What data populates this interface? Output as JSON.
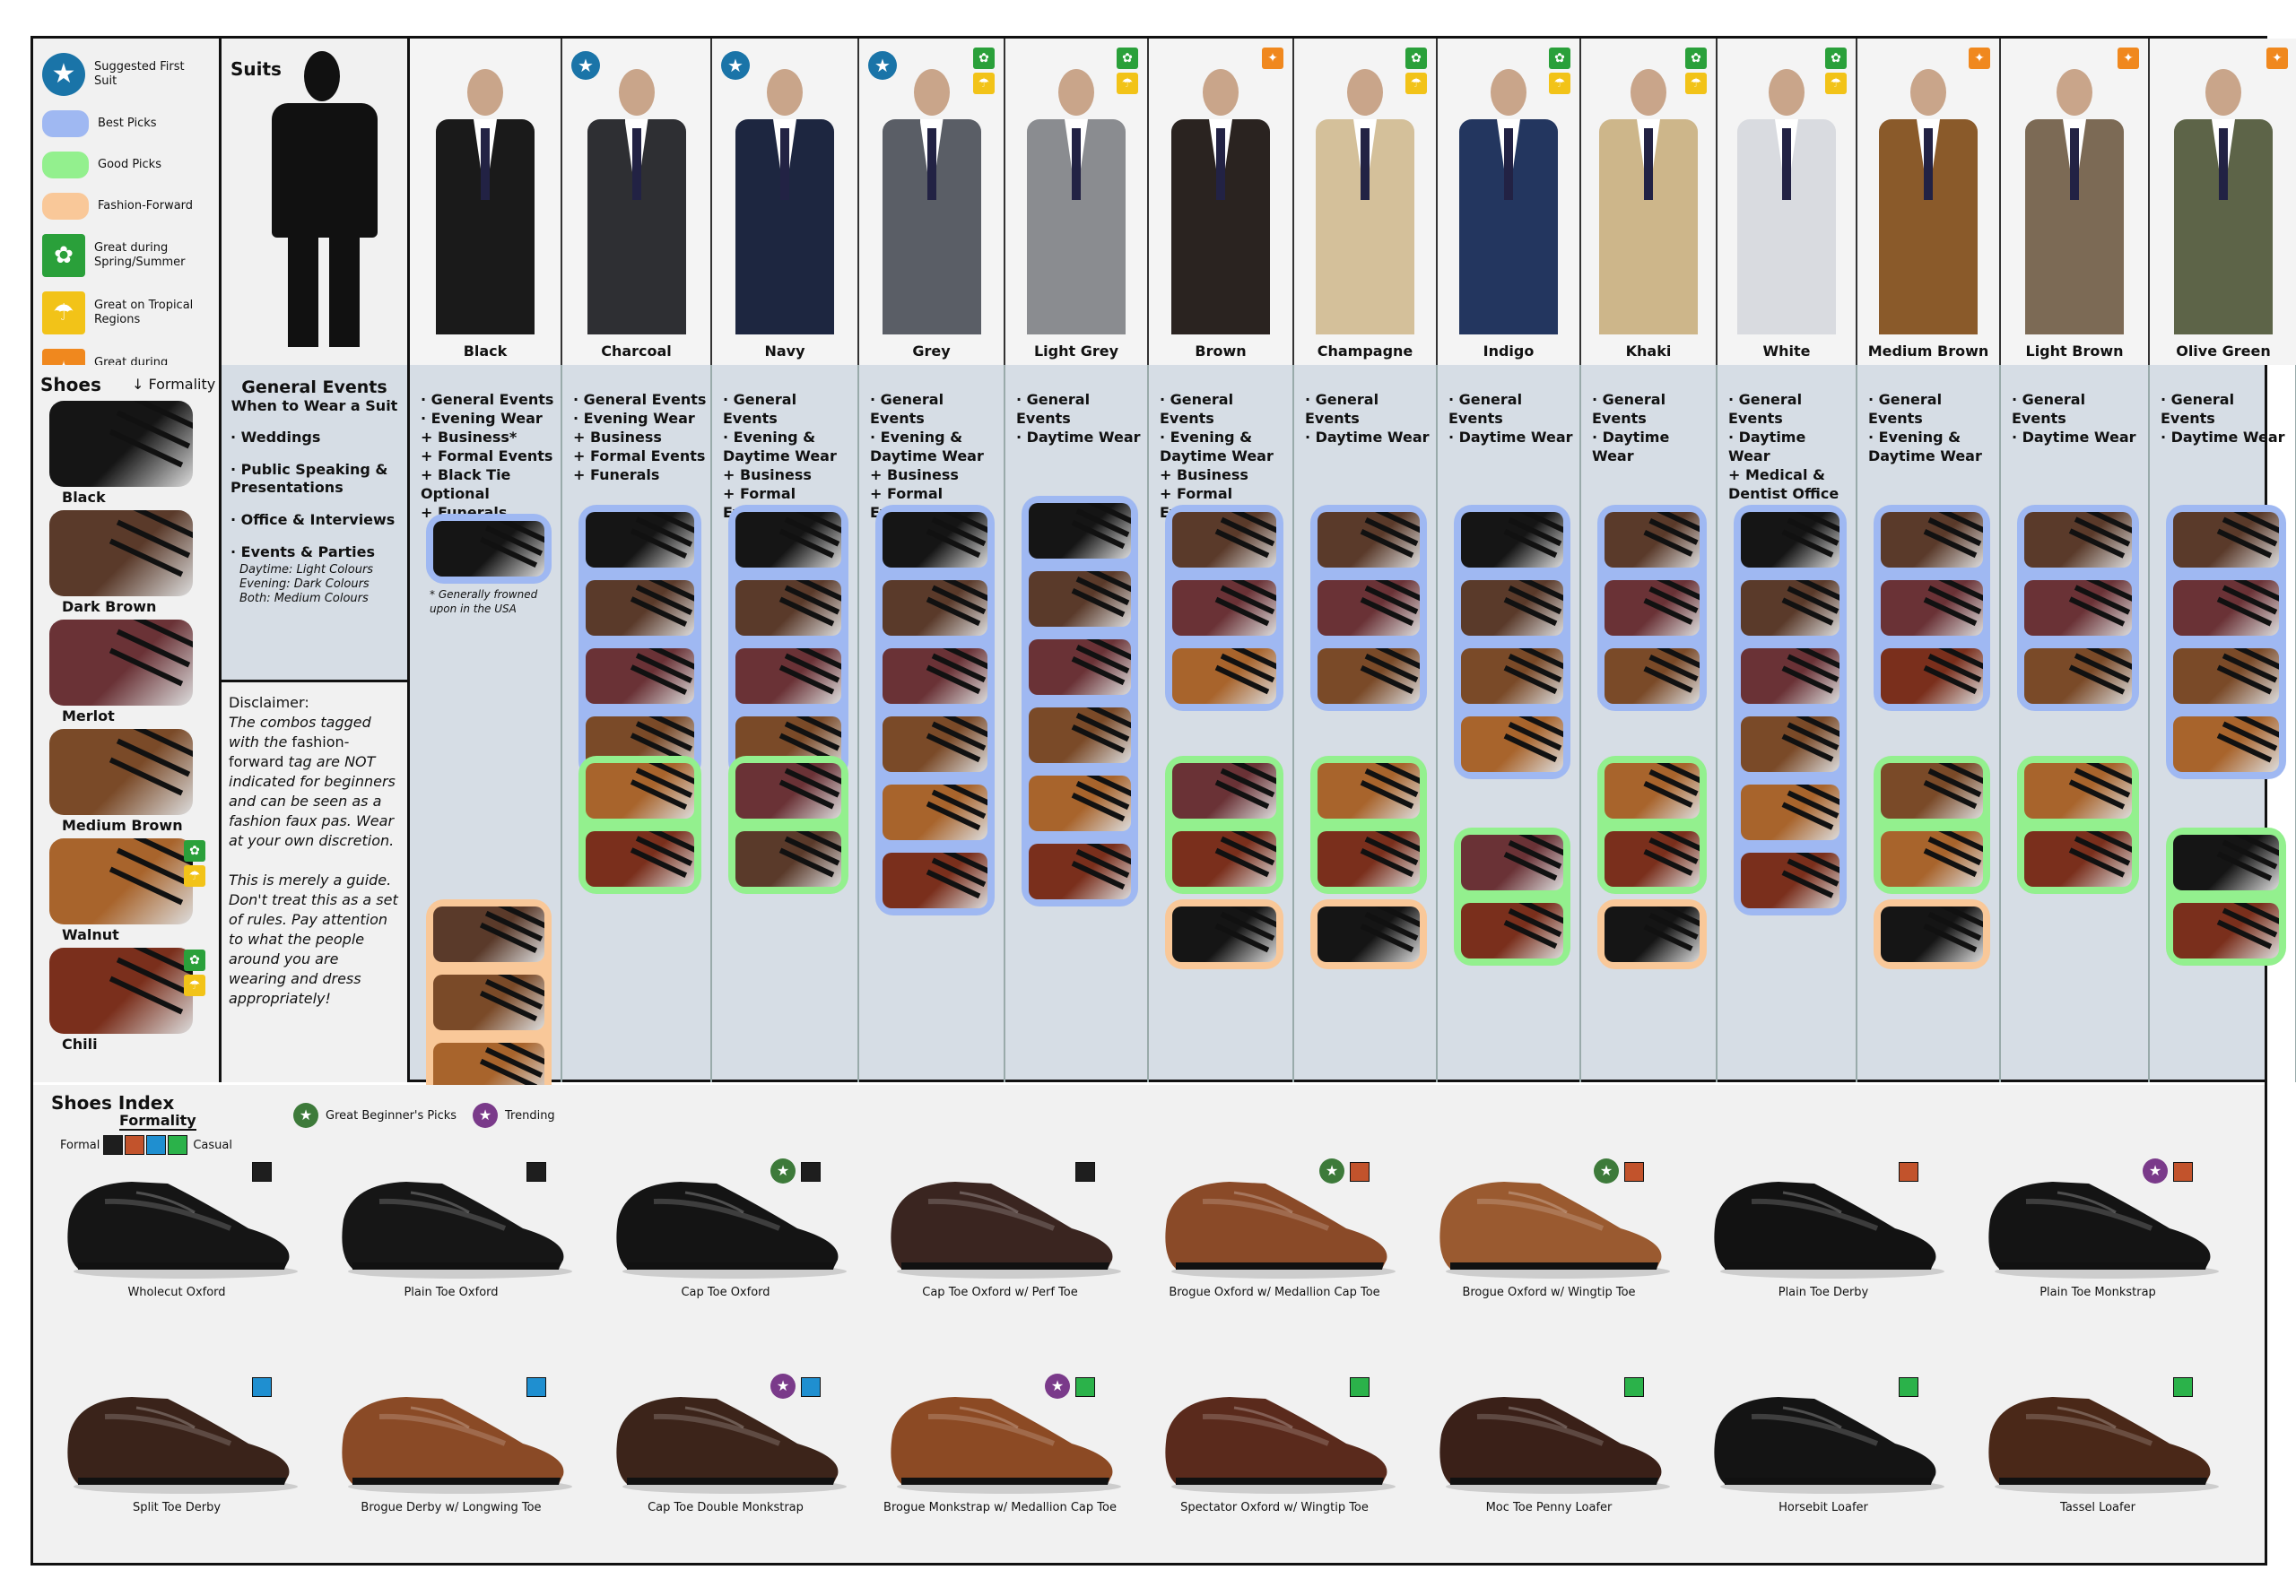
{
  "legend": {
    "first_suit": "Suggested First Suit",
    "best": "Best Picks",
    "good": "Good Picks",
    "fashion": "Fashion-Forward",
    "spring": "Great during Spring/Summer",
    "tropical": "Great on Tropical Regions",
    "autumn": "Great during Autumn",
    "colors": {
      "best": "#9fb8f2",
      "good": "#93f08e",
      "fashion": "#f9c899",
      "first_suit": "#1a74a8",
      "spring": "#2aa03a",
      "tropical": "#f2c318",
      "autumn": "#f0881e"
    }
  },
  "suits_title": "Suits",
  "suits": [
    {
      "name": "Black",
      "color": "#1a1a1a",
      "badges": []
    },
    {
      "name": "Charcoal",
      "color": "#2e2f33",
      "badges": [
        "star"
      ]
    },
    {
      "name": "Navy",
      "color": "#1d2640",
      "badges": [
        "star"
      ]
    },
    {
      "name": "Grey",
      "color": "#5a5e66",
      "badges": [
        "star",
        "spring",
        "tropical"
      ]
    },
    {
      "name": "Light Grey",
      "color": "#8a8c90",
      "badges": [
        "spring",
        "tropical"
      ]
    },
    {
      "name": "Brown",
      "color": "#2a2320",
      "badges": [
        "autumn"
      ]
    },
    {
      "name": "Champagne",
      "color": "#d4c09a",
      "badges": [
        "spring",
        "tropical"
      ]
    },
    {
      "name": "Indigo",
      "color": "#23365f",
      "badges": [
        "spring",
        "tropical"
      ]
    },
    {
      "name": "Khaki",
      "color": "#cdb68a",
      "badges": [
        "spring",
        "tropical"
      ]
    },
    {
      "name": "White",
      "color": "#d9dbe0",
      "badges": [
        "spring",
        "tropical"
      ]
    },
    {
      "name": "Medium Brown",
      "color": "#8a5a2a",
      "badges": [
        "autumn"
      ]
    },
    {
      "name": "Light Brown",
      "color": "#7c6a55",
      "badges": [
        "autumn"
      ]
    },
    {
      "name": "Olive Green",
      "color": "#5d6448",
      "badges": [
        "autumn"
      ]
    }
  ],
  "shoes_title": "Shoes",
  "formality_label": "↓ Formality",
  "shoes": [
    {
      "name": "Black",
      "color": "#151515",
      "badges": []
    },
    {
      "name": "Dark Brown",
      "color": "#5a3a2a",
      "badges": []
    },
    {
      "name": "Merlot",
      "color": "#6a3236",
      "badges": []
    },
    {
      "name": "Medium Brown",
      "color": "#7a4a28",
      "badges": []
    },
    {
      "name": "Walnut",
      "color": "#a8642c",
      "badges": [
        "spring",
        "tropical"
      ]
    },
    {
      "name": "Chili",
      "color": "#7a2f1c",
      "badges": [
        "spring",
        "tropical"
      ]
    }
  ],
  "events": {
    "title": "General Events",
    "subtitle": "When to Wear a Suit",
    "items": [
      "· Weddings",
      "· Public Speaking & Presentations",
      "· Office & Interviews",
      "· Events & Parties"
    ],
    "sub_notes": [
      "Daytime: Light Colours",
      "Evening: Dark Colours",
      "Both: Medium Colours"
    ]
  },
  "disclaimer": {
    "title": "Disclaimer:",
    "p1a": "The combos tagged with the",
    "p1b": "fashion-forward",
    "p1c": "tag are NOT indicated for beginners and can be seen as a fashion faux pas. Wear at your own discretion.",
    "p2": "This is merely a guide. Don't treat this as a set of rules. Pay attention to what the people around you are wearing and dress appropriately!"
  },
  "matrix": [
    {
      "text": "· General Events\n· Evening Wear\n+ Business*\n+ Formal Events\n+ Black Tie\n  Optional\n+ Funerals",
      "note": "* Generally frowned upon in the USA"
    },
    {
      "text": "· General Events\n· Evening Wear\n+ Business\n+ Formal Events\n+ Funerals",
      "note": ""
    },
    {
      "text": "· General Events\n· Evening &\n  Daytime Wear\n+ Business\n+ Formal Events",
      "note": ""
    },
    {
      "text": "· General Events\n· Evening &\n  Daytime Wear\n+ Business\n+ Formal Events",
      "note": ""
    },
    {
      "text": "· General Events\n· Daytime Wear",
      "note": ""
    },
    {
      "text": "· General Events\n· Evening &\n  Daytime Wear\n+ Business\n+ Formal Events",
      "note": ""
    },
    {
      "text": "· General Events\n· Daytime Wear",
      "note": ""
    },
    {
      "text": "· General Events\n· Daytime Wear",
      "note": ""
    },
    {
      "text": "· General Events\n· Daytime Wear",
      "note": ""
    },
    {
      "text": "· General Events\n· Daytime Wear\n+ Medical &\n  Dentist Office",
      "note": ""
    },
    {
      "text": "· General Events\n· Evening &\n  Daytime Wear",
      "note": ""
    },
    {
      "text": "· General Events\n· Daytime Wear",
      "note": ""
    },
    {
      "text": "· General Events\n· Daytime Wear",
      "note": ""
    }
  ],
  "index": {
    "title": "Shoes Index",
    "formality": "Formality",
    "formal": "Formal",
    "casual": "Casual",
    "beginner": "Great Beginner's Picks",
    "trending": "Trending",
    "scale_colors": [
      "#1e1e1e",
      "#c2532c",
      "#1f8fd0",
      "#2bb24a"
    ],
    "shoes_row1": [
      {
        "name": "Wholecut Oxford",
        "color": "#151515",
        "tag": "#1e1e1e",
        "mark": ""
      },
      {
        "name": "Plain Toe Oxford",
        "color": "#161616",
        "tag": "#1e1e1e",
        "mark": ""
      },
      {
        "name": "Cap Toe Oxford",
        "color": "#141414",
        "tag": "#1e1e1e",
        "mark": "beginner"
      },
      {
        "name": "Cap Toe Oxford w/ Perf Toe",
        "color": "#3a2520",
        "tag": "#1e1e1e",
        "mark": ""
      },
      {
        "name": "Brogue Oxford w/ Medallion Cap Toe",
        "color": "#8a4a28",
        "tag": "#c2532c",
        "mark": "beginner"
      },
      {
        "name": "Brogue Oxford w/ Wingtip Toe",
        "color": "#9a5a30",
        "tag": "#c2532c",
        "mark": "beginner"
      },
      {
        "name": "Plain Toe Derby",
        "color": "#121212",
        "tag": "#c2532c",
        "mark": ""
      },
      {
        "name": "Plain Toe Monkstrap",
        "color": "#141414",
        "tag": "#c2532c",
        "mark": "trending"
      }
    ],
    "shoes_row2": [
      {
        "name": "Split Toe Derby",
        "color": "#3a231a",
        "tag": "#1f8fd0",
        "mark": ""
      },
      {
        "name": "Brogue Derby w/ Longwing Toe",
        "color": "#8a4a26",
        "tag": "#1f8fd0",
        "mark": ""
      },
      {
        "name": "Cap Toe Double Monkstrap",
        "color": "#3c241a",
        "tag": "#1f8fd0",
        "mark": "trending"
      },
      {
        "name": "Brogue Monkstrap w/ Medallion Cap Toe",
        "color": "#8c4a24",
        "tag": "#2bb24a",
        "mark": "trending"
      },
      {
        "name": "Spectator Oxford w/ Wingtip Toe",
        "color": "#5a2a1c",
        "tag": "#2bb24a",
        "mark": ""
      },
      {
        "name": "Moc Toe Penny Loafer",
        "color": "#3a2018",
        "tag": "#2bb24a",
        "mark": ""
      },
      {
        "name": "Horsebit Loafer",
        "color": "#141414",
        "tag": "#2bb24a",
        "mark": ""
      },
      {
        "name": "Tassel Loafer",
        "color": "#4a2818",
        "tag": "#2bb24a",
        "mark": ""
      }
    ]
  }
}
